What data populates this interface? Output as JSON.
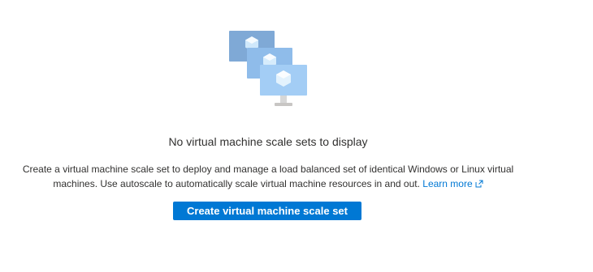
{
  "empty_state": {
    "illustration_icon": "virtual-machine-scale-set-icon",
    "title": "No virtual machine scale sets to display",
    "description": "Create a virtual machine scale set to deploy and manage a load balanced set of identical Windows or Linux virtual machines. Use autoscale to automatically scale virtual machine resources in and out.",
    "learn_more_label": "Learn more",
    "learn_more_icon": "external-link-icon",
    "create_button_label": "Create virtual machine scale set"
  },
  "colors": {
    "accent": "#0078d4",
    "text": "#323130",
    "monitor_back": "#7fa9d6",
    "monitor_mid": "#8fbcea",
    "monitor_front": "#a3cdf5",
    "stand": "#c8c6c4"
  }
}
